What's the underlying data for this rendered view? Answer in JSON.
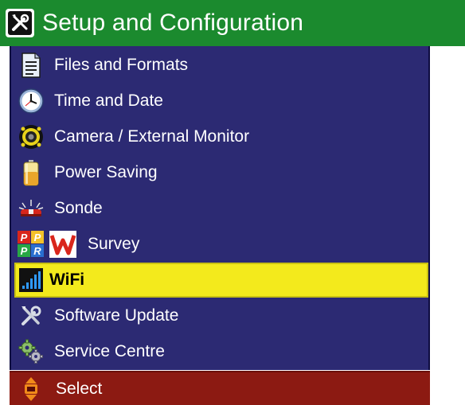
{
  "header": {
    "title": "Setup and Configuration",
    "icon": "tools-icon"
  },
  "menu": {
    "items": [
      {
        "label": "Files and Formats",
        "icon": "document-icon",
        "selected": false
      },
      {
        "label": "Time and Date",
        "icon": "clock-icon",
        "selected": false
      },
      {
        "label": "Camera / External Monitor",
        "icon": "camera-lens-icon",
        "selected": false
      },
      {
        "label": "Power Saving",
        "icon": "battery-icon",
        "selected": false
      },
      {
        "label": "Sonde",
        "icon": "sonde-icon",
        "selected": false
      },
      {
        "label": "Survey",
        "icon": "survey-logo-icon",
        "selected": false,
        "logo_text": [
          "P",
          "P",
          "P",
          "R"
        ]
      },
      {
        "label": "WiFi",
        "icon": "signal-bars-icon",
        "selected": true
      },
      {
        "label": "Software Update",
        "icon": "wrench-screwdriver-icon",
        "selected": false
      },
      {
        "label": "Service Centre",
        "icon": "gears-icon",
        "selected": false
      }
    ]
  },
  "footer": {
    "label": "Select",
    "icon": "ok-scroll-icon"
  },
  "colors": {
    "title_bar": "#1b8a2e",
    "panel": "#2c2a73",
    "selected": "#f3ea1c",
    "footer": "#8c1a12"
  }
}
